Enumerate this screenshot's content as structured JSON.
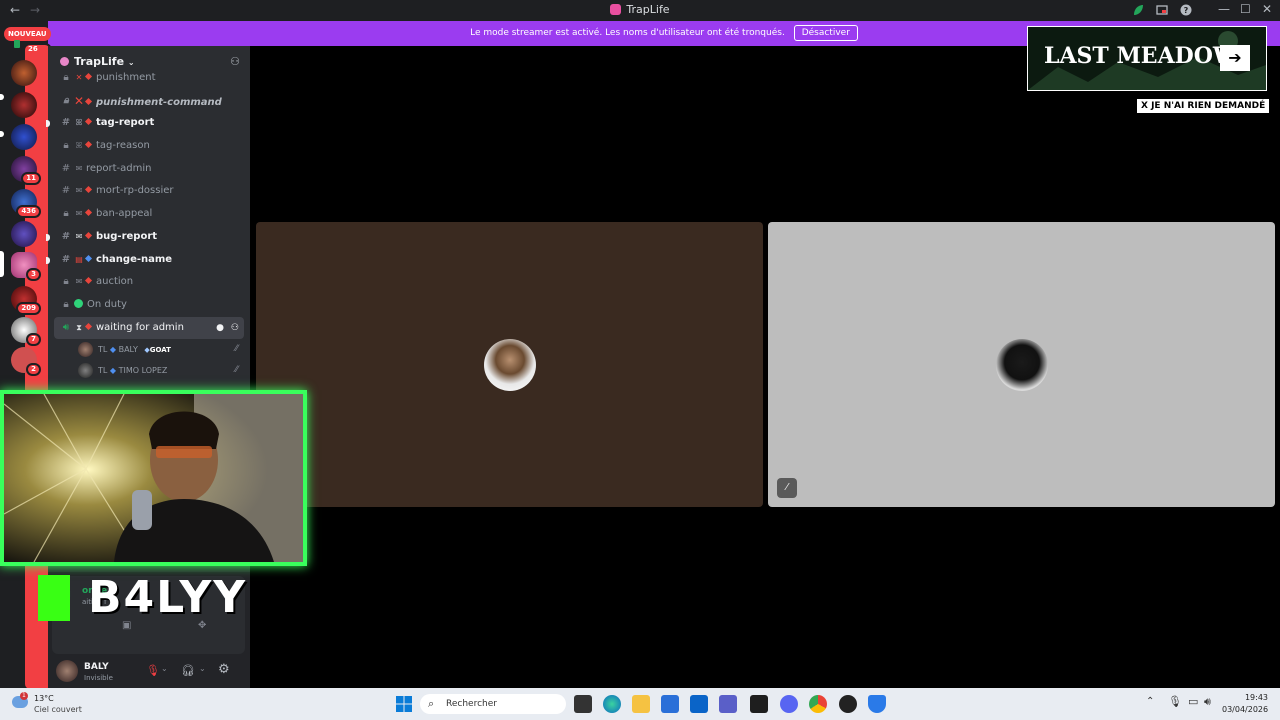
{
  "window": {
    "title": "TrapLife",
    "back_icon": "←",
    "forward_icon": "→"
  },
  "banner": {
    "text": "Le mode streamer est activé. Les noms d'utilisateur ont été tronqués.",
    "button": "Désactiver"
  },
  "guilds": {
    "new_label": "NOUVEAU",
    "badges": [
      "26",
      "11",
      "436",
      "3",
      "209",
      "7",
      "2"
    ]
  },
  "server": {
    "name": "TrapLife"
  },
  "channels": [
    {
      "name": "punishment",
      "icon": "lock-icon",
      "sub": "✕"
    },
    {
      "name": "punishment-command",
      "icon": "lock-icon",
      "sub": "✕"
    },
    {
      "name": "tag-report",
      "icon": "hash-icon",
      "sub": "ꕤ"
    },
    {
      "name": "tag-reason",
      "icon": "lock-icon",
      "sub": "ꕤ"
    },
    {
      "name": "report-admin",
      "icon": "hash-icon",
      "sub": "✉"
    },
    {
      "name": "mort-rp-dossier",
      "icon": "hash-icon",
      "sub": "✉"
    },
    {
      "name": "ban-appeal",
      "icon": "lock-icon",
      "sub": "✉"
    },
    {
      "name": "bug-report",
      "icon": "hash-icon",
      "sub": "✉"
    },
    {
      "name": "change-name",
      "icon": "hash-icon",
      "sub": "▤"
    },
    {
      "name": "auction",
      "icon": "lock-icon",
      "sub": "✉"
    },
    {
      "name": "On duty",
      "icon": "lock-icon"
    },
    {
      "name": "waiting for admin",
      "icon": "speaker-icon",
      "sub": "⧗"
    }
  ],
  "voice_users": [
    {
      "prefix": "TL",
      "name": "BALY",
      "tag": "GOAT"
    },
    {
      "prefix": "TL",
      "name": "TIMO LOPEZ",
      "tag": ""
    }
  ],
  "overlay": {
    "name": "B4LYY",
    "voice_status": "onne",
    "voice_sub": "aiting f"
  },
  "user_panel": {
    "name": "BALY",
    "status": "Invisible"
  },
  "ad": {
    "title": "LAST MEADOW",
    "cta": "X JE N'AI RIEN DEMANDÉ"
  },
  "taskbar": {
    "weather_temp": "13°C",
    "weather_desc": "Ciel couvert",
    "weather_badge": "1",
    "search_placeholder": "Rechercher",
    "time": "19:43",
    "date": "03/04/2026"
  },
  "colors": {
    "banner": "#9b3cf0",
    "cam_border": "#39ff5c",
    "tile_left": "#3a2a20",
    "tile_right": "#bdbdbd"
  }
}
